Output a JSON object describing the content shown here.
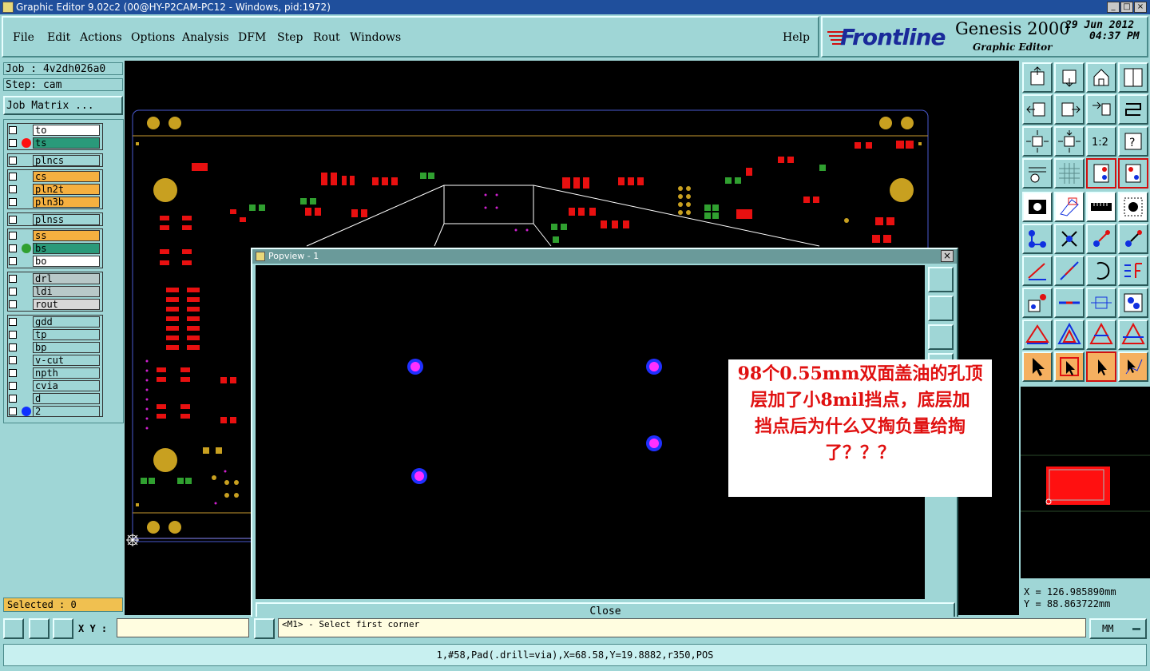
{
  "window": {
    "title": "Graphic Editor 9.02c2 (00@HY-P2CAM-PC12 - Windows, pid:1972)"
  },
  "menu": {
    "items": [
      "File",
      "Edit",
      "Actions",
      "Options",
      "Analysis",
      "DFM",
      "Step",
      "Rout",
      "Windows"
    ],
    "help": "Help"
  },
  "brand": {
    "logo_text": "Frontline",
    "product": "Genesis 2000",
    "subtitle": "Graphic Editor",
    "date": "29 Jun 2012",
    "time": "04:37 PM"
  },
  "job": {
    "job_label": "Job : 4v2dh026a0",
    "step_label": "Step: cam",
    "matrix_button": "Job Matrix ..."
  },
  "layers": [
    {
      "name": "to",
      "color": "#ffffff",
      "dot": ""
    },
    {
      "name": "ts",
      "color": "#2a9a7a",
      "dot": "#ff1010"
    },
    {
      "name": "plncs",
      "color": "#9fd6d6",
      "dot": ""
    },
    {
      "name": "cs",
      "color": "#f5b040",
      "dot": ""
    },
    {
      "name": "pln2t",
      "color": "#f5b040",
      "dot": ""
    },
    {
      "name": "pln3b",
      "color": "#f5b040",
      "dot": ""
    },
    {
      "name": "plnss",
      "color": "#9fd6d6",
      "dot": ""
    },
    {
      "name": "ss",
      "color": "#f5b040",
      "dot": ""
    },
    {
      "name": "bs",
      "color": "#2a9a7a",
      "dot": "#30a030"
    },
    {
      "name": "bo",
      "color": "#ffffff",
      "dot": ""
    },
    {
      "name": "drl",
      "color": "#b8c8c8",
      "dot": ""
    },
    {
      "name": "ldi",
      "color": "#b8c8c8",
      "dot": ""
    },
    {
      "name": "rout",
      "color": "#d8d8d8",
      "dot": ""
    },
    {
      "name": "gdd",
      "color": "#9fd6d6",
      "dot": ""
    },
    {
      "name": "tp",
      "color": "#9fd6d6",
      "dot": ""
    },
    {
      "name": "bp",
      "color": "#9fd6d6",
      "dot": ""
    },
    {
      "name": "v-cut",
      "color": "#9fd6d6",
      "dot": ""
    },
    {
      "name": "npth",
      "color": "#9fd6d6",
      "dot": ""
    },
    {
      "name": "cvia",
      "color": "#9fd6d6",
      "dot": ""
    },
    {
      "name": "d",
      "color": "#9fd6d6",
      "dot": ""
    },
    {
      "name": "2",
      "color": "#9fd6d6",
      "dot": "#1030ff"
    }
  ],
  "popview": {
    "title": "Popview - 1",
    "close_label": "Close",
    "pads": [
      {
        "fill": "#ff30ff",
        "ring": "#2030ff"
      }
    ]
  },
  "annotation": {
    "lines": [
      "98个0.55mm双面盖油的孔顶",
      "层加了小8mil挡点，底层加",
      "挡点后为什么又掏负量给掏",
      "了？？？"
    ]
  },
  "coordinates": {
    "x": "X = 126.985890mm",
    "y": "Y = 88.863722mm"
  },
  "selected": "Selected : 0",
  "xy_label": "X Y :",
  "xy_value": "",
  "prompt": "<M1> - Select first corner",
  "units": "MM",
  "status": "1,#58,Pad(.drill=via),X=68.58,Y=19.8882,r350,POS"
}
